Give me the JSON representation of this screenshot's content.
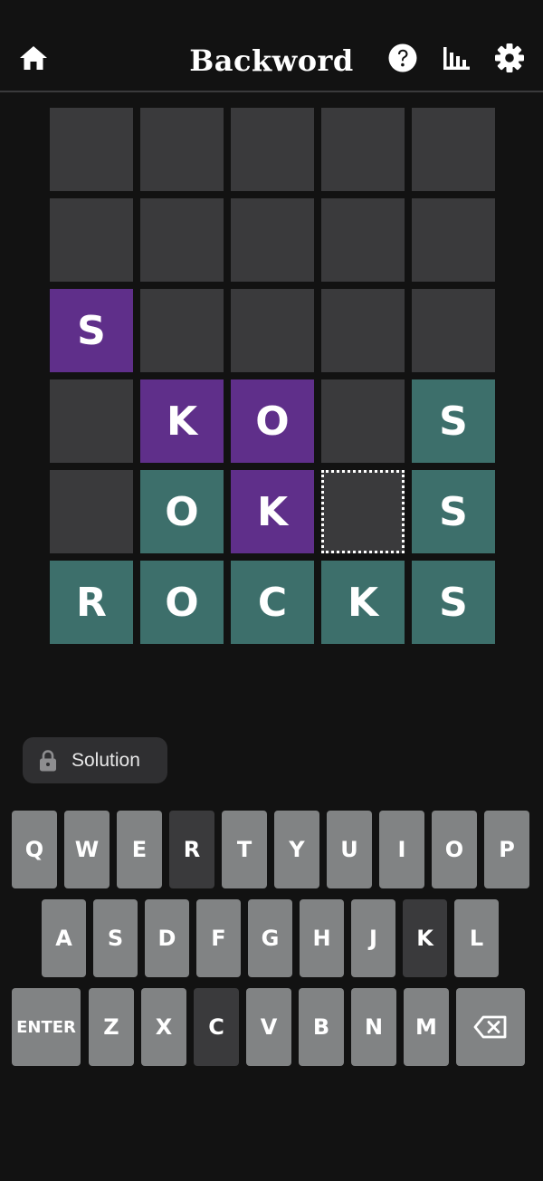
{
  "header": {
    "title": "Backword",
    "icons": [
      "home-icon",
      "help-icon",
      "stats-icon",
      "settings-icon"
    ]
  },
  "board": {
    "rows": [
      [
        {
          "letter": "",
          "state": "empty"
        },
        {
          "letter": "",
          "state": "empty"
        },
        {
          "letter": "",
          "state": "empty"
        },
        {
          "letter": "",
          "state": "empty"
        },
        {
          "letter": "",
          "state": "empty"
        }
      ],
      [
        {
          "letter": "",
          "state": "empty"
        },
        {
          "letter": "",
          "state": "empty"
        },
        {
          "letter": "",
          "state": "empty"
        },
        {
          "letter": "",
          "state": "empty"
        },
        {
          "letter": "",
          "state": "empty"
        }
      ],
      [
        {
          "letter": "S",
          "state": "purple"
        },
        {
          "letter": "",
          "state": "empty"
        },
        {
          "letter": "",
          "state": "empty"
        },
        {
          "letter": "",
          "state": "empty"
        },
        {
          "letter": "",
          "state": "empty"
        }
      ],
      [
        {
          "letter": "",
          "state": "empty"
        },
        {
          "letter": "K",
          "state": "purple"
        },
        {
          "letter": "O",
          "state": "purple"
        },
        {
          "letter": "",
          "state": "empty"
        },
        {
          "letter": "S",
          "state": "teal"
        }
      ],
      [
        {
          "letter": "",
          "state": "empty"
        },
        {
          "letter": "O",
          "state": "teal"
        },
        {
          "letter": "K",
          "state": "purple"
        },
        {
          "letter": "",
          "state": "selected"
        },
        {
          "letter": "S",
          "state": "teal"
        }
      ],
      [
        {
          "letter": "R",
          "state": "teal"
        },
        {
          "letter": "O",
          "state": "teal"
        },
        {
          "letter": "C",
          "state": "teal"
        },
        {
          "letter": "K",
          "state": "teal"
        },
        {
          "letter": "S",
          "state": "teal"
        }
      ]
    ]
  },
  "solution": {
    "label": "Solution",
    "icon": "lock-icon"
  },
  "keyboard": {
    "row1": [
      {
        "key": "Q",
        "state": "normal"
      },
      {
        "key": "W",
        "state": "normal"
      },
      {
        "key": "E",
        "state": "normal"
      },
      {
        "key": "R",
        "state": "dark"
      },
      {
        "key": "T",
        "state": "normal"
      },
      {
        "key": "Y",
        "state": "normal"
      },
      {
        "key": "U",
        "state": "normal"
      },
      {
        "key": "I",
        "state": "normal"
      },
      {
        "key": "O",
        "state": "normal"
      },
      {
        "key": "P",
        "state": "normal"
      }
    ],
    "row2": [
      {
        "key": "A",
        "state": "normal"
      },
      {
        "key": "S",
        "state": "normal"
      },
      {
        "key": "D",
        "state": "normal"
      },
      {
        "key": "F",
        "state": "normal"
      },
      {
        "key": "G",
        "state": "normal"
      },
      {
        "key": "H",
        "state": "normal"
      },
      {
        "key": "J",
        "state": "normal"
      },
      {
        "key": "K",
        "state": "dark"
      },
      {
        "key": "L",
        "state": "normal"
      }
    ],
    "row3": [
      {
        "key": "ENTER",
        "state": "normal"
      },
      {
        "key": "Z",
        "state": "normal"
      },
      {
        "key": "X",
        "state": "normal"
      },
      {
        "key": "C",
        "state": "dark"
      },
      {
        "key": "V",
        "state": "normal"
      },
      {
        "key": "B",
        "state": "normal"
      },
      {
        "key": "N",
        "state": "normal"
      },
      {
        "key": "M",
        "state": "normal"
      }
    ],
    "backspace_icon": "backspace-icon"
  },
  "colors": {
    "background": "#121212",
    "empty_tile": "#3a3a3c",
    "purple": "#5f2f8a",
    "teal": "#3d6f6b",
    "key": "#818384",
    "key_dark": "#3a3a3c"
  }
}
